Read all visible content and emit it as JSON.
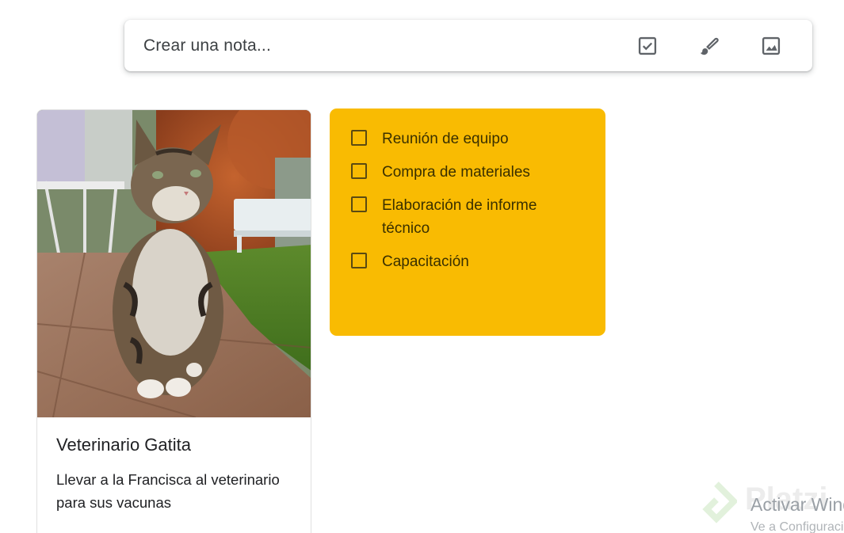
{
  "note_bar": {
    "placeholder": "Crear una nota...",
    "icons": [
      "checkbox-icon",
      "brush-icon",
      "image-icon"
    ]
  },
  "notes": [
    {
      "type": "image",
      "title": "Veterinario Gatita",
      "body": "Llevar a la Francisca al veterinario para sus vacunas",
      "image": "cat-photo"
    },
    {
      "type": "checklist",
      "color": "#f9bb02",
      "items": [
        {
          "label": "Reunión de equipo",
          "checked": false
        },
        {
          "label": "Compra de materiales",
          "checked": false
        },
        {
          "label": "Elaboración de informe técnico",
          "checked": false
        },
        {
          "label": "Capacitación",
          "checked": false
        }
      ]
    }
  ],
  "watermarks": {
    "brand": "Platzi",
    "activate": "Activar Windows",
    "activate_sub": "Ve a Configuración"
  }
}
